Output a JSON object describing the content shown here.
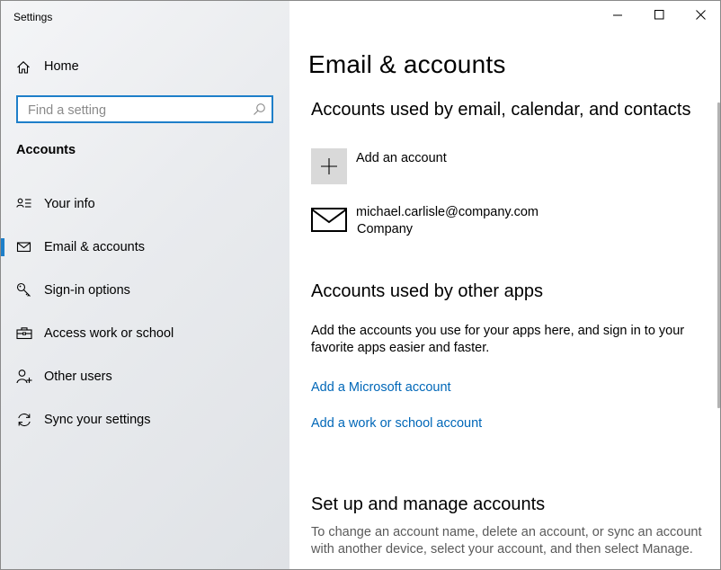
{
  "window": {
    "title": "Settings",
    "controls": {
      "minimize": "minimize",
      "maximize": "maximize",
      "close": "close"
    }
  },
  "sidebar": {
    "home_label": "Home",
    "search": {
      "placeholder": "Find a setting",
      "value": ""
    },
    "section_label": "Accounts",
    "items": [
      {
        "label": "Your info",
        "icon": "person-list-icon"
      },
      {
        "label": "Email & accounts",
        "icon": "envelope-icon",
        "active": true
      },
      {
        "label": "Sign-in options",
        "icon": "key-icon"
      },
      {
        "label": "Access work or school",
        "icon": "briefcase-icon"
      },
      {
        "label": "Other users",
        "icon": "person-add-icon"
      },
      {
        "label": "Sync your settings",
        "icon": "sync-icon"
      }
    ]
  },
  "main": {
    "title": "Email & accounts",
    "email_section": {
      "header": "Accounts used by email, calendar, and contacts",
      "add_account_label": "Add an account",
      "account": {
        "email": "michael.carlisle@company.com",
        "type": "Company"
      }
    },
    "other_apps_section": {
      "header": "Accounts used by other apps",
      "description": "Add the accounts you use for your apps here, and sign in to your favorite apps easier and faster.",
      "links": [
        "Add a Microsoft account",
        "Add a work or school account"
      ]
    },
    "manage_section": {
      "header": "Set up and manage accounts",
      "description": "To change an account name, delete an account, or sync an account with another device, select your account, and then select Manage."
    }
  },
  "colors": {
    "accent": "#1e7fc9",
    "link": "#0067b8",
    "sidebar_bg": "#eaecef"
  }
}
